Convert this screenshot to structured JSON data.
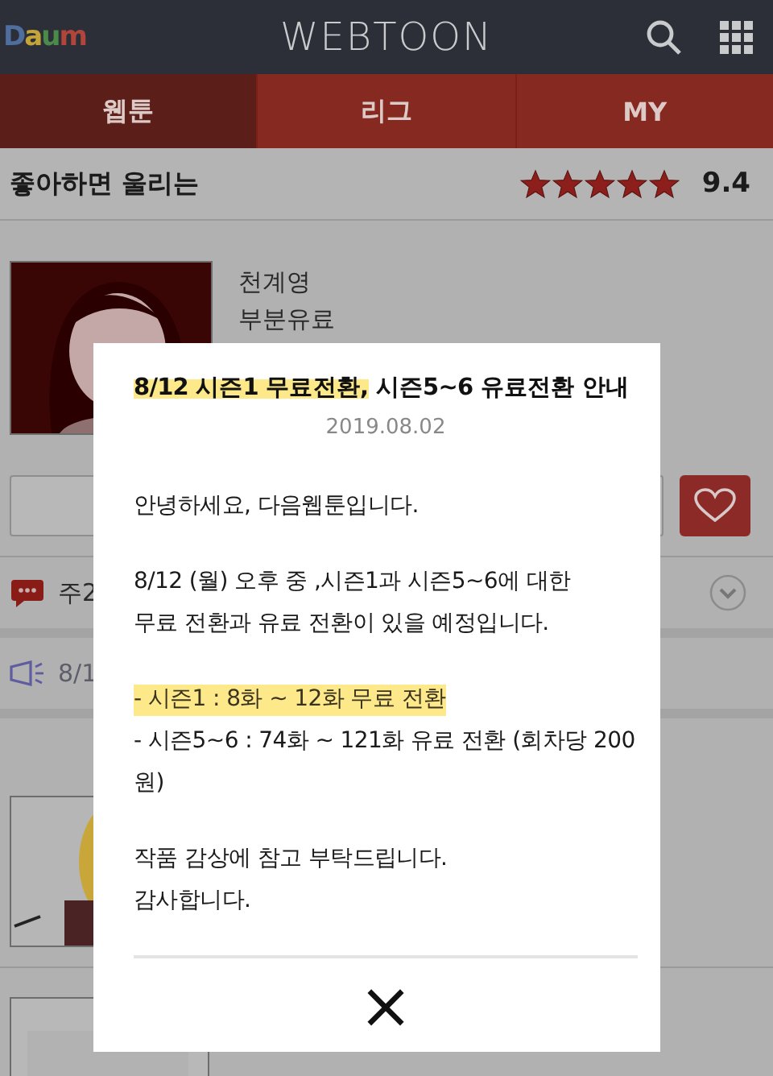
{
  "header": {
    "logo": "Daum",
    "title": "WEBTOON"
  },
  "tabs": [
    {
      "label": "웹툰",
      "selected": true
    },
    {
      "label": "리그",
      "selected": false
    },
    {
      "label": "MY",
      "selected": false
    }
  ],
  "work": {
    "title": "좋아하면 울리는",
    "stars": 5,
    "rating": "9.4",
    "author": "천계영",
    "pricing": "부분유료"
  },
  "info_rows": [
    {
      "kind": "comment",
      "text": "주2"
    },
    {
      "kind": "notice",
      "text": "8/1"
    }
  ],
  "modal": {
    "title": [
      {
        "text": "8/12 시즌1 무료전환,",
        "highlighted": true
      },
      {
        "text": " 시즌5~6 유료전환 안내",
        "highlighted": false
      }
    ],
    "date": "2019.08.02",
    "paragraphs": [
      [
        {
          "text": "안녕하세요, 다음웹툰입니다.",
          "highlighted": false
        }
      ],
      [
        {
          "text": "8/12 (월) 오후 중 ,시즌1과 시즌5~6에 대한",
          "highlighted": false
        },
        {
          "text": "무료 전환과 유료 전환이 있을 예정입니다.",
          "highlighted": false
        }
      ],
      [
        {
          "text": "- 시즌1 : 8화 ~ 12화 무료 전환",
          "highlighted": true
        },
        {
          "text": "- 시즌5~6 : 74화 ~ 121화 유료 전환 (회차당 200원)",
          "highlighted": false
        }
      ],
      [
        {
          "text": "작품 감상에 참고 부탁드립니다.",
          "highlighted": false
        },
        {
          "text": "감사합니다.",
          "highlighted": false
        }
      ]
    ],
    "close": "×"
  }
}
